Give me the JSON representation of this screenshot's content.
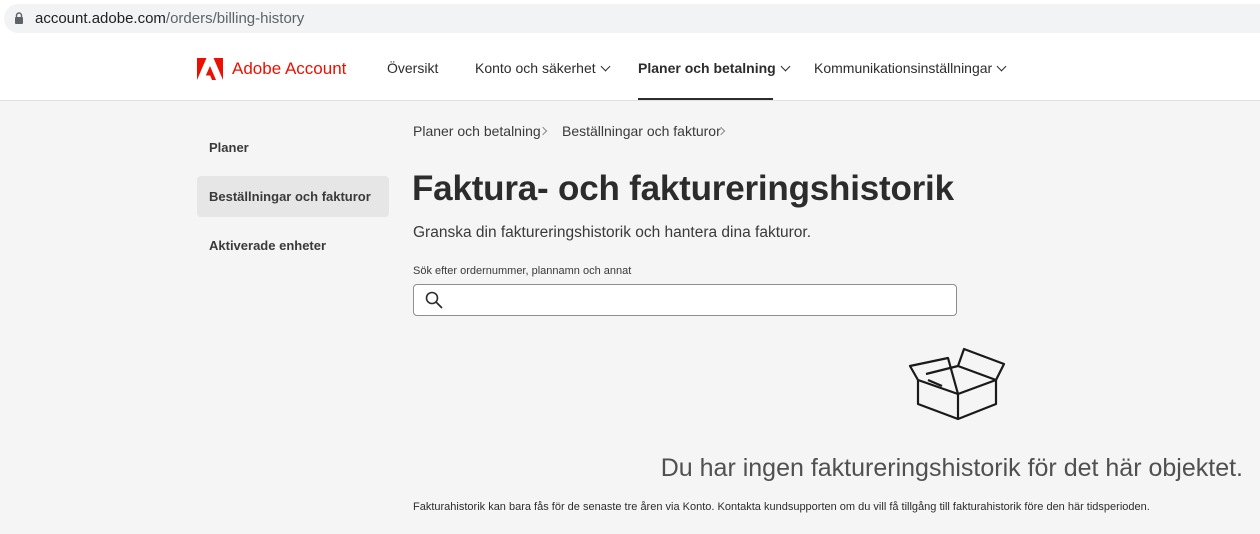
{
  "browser": {
    "url_host": "account.adobe.com",
    "url_path": "/orders/billing-history"
  },
  "header": {
    "brand": "Adobe Account",
    "brand_color": "#eb1000",
    "nav": [
      {
        "label": "Översikt",
        "dropdown": false,
        "active": false
      },
      {
        "label": "Konto och säkerhet",
        "dropdown": true,
        "active": false
      },
      {
        "label": "Planer och betalning",
        "dropdown": true,
        "active": true
      },
      {
        "label": "Kommunikationsinställningar",
        "dropdown": true,
        "active": false
      }
    ]
  },
  "sidebar": {
    "items": [
      {
        "label": "Planer",
        "selected": false
      },
      {
        "label": "Beställningar och fakturor",
        "selected": true
      },
      {
        "label": "Aktiverade enheter",
        "selected": false
      }
    ]
  },
  "breadcrumb": [
    "Planer och betalning",
    "Beställningar och fakturor"
  ],
  "main": {
    "title": "Faktura- och faktureringshistorik",
    "subtitle": "Granska din faktureringshistorik och hantera dina fakturor.",
    "search_label": "Sök efter ordernummer, plannamn och annat",
    "search_value": "",
    "search_icon": "search-icon",
    "empty_icon": "open-box-icon",
    "empty_message": "Du har ingen faktureringshistorik för det här objektet.",
    "footnote": "Fakturahistorik kan bara fås för de senaste tre åren via Konto. Kontakta kundsupporten om du vill få tillgång till fakturahistorik före den här tidsperioden."
  }
}
